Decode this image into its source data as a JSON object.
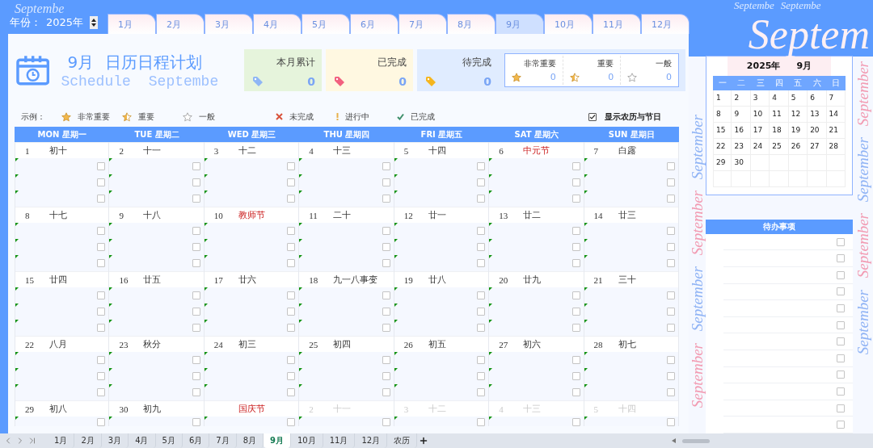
{
  "header": {
    "year_label": "年份：",
    "year": "2025年",
    "watermark": "Septembe",
    "right_watermarks": [
      "Septembe",
      "Septembe"
    ]
  },
  "month_tabs": [
    {
      "label": "1月",
      "selected": false
    },
    {
      "label": "2月",
      "selected": false
    },
    {
      "label": "3月",
      "selected": false
    },
    {
      "label": "4月",
      "selected": false
    },
    {
      "label": "5月",
      "selected": false
    },
    {
      "label": "6月",
      "selected": false
    },
    {
      "label": "7月",
      "selected": false
    },
    {
      "label": "8月",
      "selected": false
    },
    {
      "label": "9月",
      "selected": true
    },
    {
      "label": "10月",
      "selected": false
    },
    {
      "label": "11月",
      "selected": false
    },
    {
      "label": "12月",
      "selected": false
    }
  ],
  "title": {
    "month": "9月",
    "name": "日历日程计划",
    "subtitle": "Schedule",
    "subtitle_month": "Septembe"
  },
  "stats": [
    {
      "kind": "total",
      "label": "本月累计",
      "value": "0"
    },
    {
      "kind": "done",
      "label": "已完成",
      "value": "0"
    },
    {
      "kind": "pending",
      "label": "待完成",
      "value": "0"
    }
  ],
  "priorities": [
    {
      "kind": "star_full",
      "label": "非常重要",
      "value": "0"
    },
    {
      "kind": "star_half",
      "label": "重要",
      "value": "0"
    },
    {
      "kind": "star_empty",
      "label": "一般",
      "value": "0"
    }
  ],
  "legend": {
    "label": "示例：",
    "items": [
      {
        "kind": "star_full",
        "label": "非常重要"
      },
      {
        "kind": "star_half",
        "label": "重要"
      },
      {
        "kind": "star_empty",
        "label": "一般"
      },
      {
        "kind": "cross",
        "label": "未完成"
      },
      {
        "kind": "exclaim",
        "label": "进行中"
      },
      {
        "kind": "tick",
        "label": "已完成"
      }
    ]
  },
  "lunar_toggle": {
    "label": "显示农历与节日",
    "checked": true
  },
  "weekdays": [
    "MON 星期一",
    "TUE 星期二",
    "WED 星期三",
    "THU 星期四",
    "FRI 星期五",
    "SAT 星期六",
    "SUN 星期日"
  ],
  "weeks": [
    {
      "days": [
        {
          "day": "1",
          "lunar": "初十",
          "holiday": false,
          "other_month": false,
          "tasks": [
            {
              "checked": false
            },
            {
              "checked": false
            },
            {
              "checked": false
            }
          ]
        },
        {
          "day": "2",
          "lunar": "十一",
          "holiday": false,
          "other_month": false,
          "tasks": [
            {
              "checked": false
            },
            {
              "checked": false
            },
            {
              "checked": false
            }
          ]
        },
        {
          "day": "3",
          "lunar": "十二",
          "holiday": false,
          "other_month": false,
          "tasks": [
            {
              "checked": false
            },
            {
              "checked": false
            },
            {
              "checked": false
            }
          ]
        },
        {
          "day": "4",
          "lunar": "十三",
          "holiday": false,
          "other_month": false,
          "tasks": [
            {
              "checked": false
            },
            {
              "checked": false
            },
            {
              "checked": false
            }
          ]
        },
        {
          "day": "5",
          "lunar": "十四",
          "holiday": false,
          "other_month": false,
          "tasks": [
            {
              "checked": false
            },
            {
              "checked": false
            },
            {
              "checked": false
            }
          ]
        },
        {
          "day": "6",
          "lunar": "中元节",
          "holiday": true,
          "other_month": false,
          "tasks": [
            {
              "checked": false
            },
            {
              "checked": false
            },
            {
              "checked": false
            }
          ]
        },
        {
          "day": "7",
          "lunar": "白露",
          "holiday": false,
          "other_month": false,
          "tasks": [
            {
              "checked": false
            },
            {
              "checked": false
            },
            {
              "checked": false
            }
          ]
        }
      ]
    },
    {
      "days": [
        {
          "day": "8",
          "lunar": "十七",
          "holiday": false,
          "other_month": false,
          "tasks": [
            {
              "checked": false
            },
            {
              "checked": false
            },
            {
              "checked": false
            }
          ]
        },
        {
          "day": "9",
          "lunar": "十八",
          "holiday": false,
          "other_month": false,
          "tasks": [
            {
              "checked": false
            },
            {
              "checked": false
            },
            {
              "checked": false
            }
          ]
        },
        {
          "day": "10",
          "lunar": "教师节",
          "holiday": true,
          "other_month": false,
          "tasks": [
            {
              "checked": false
            },
            {
              "checked": false
            },
            {
              "checked": false
            }
          ]
        },
        {
          "day": "11",
          "lunar": "二十",
          "holiday": false,
          "other_month": false,
          "tasks": [
            {
              "checked": false
            },
            {
              "checked": false
            },
            {
              "checked": false
            }
          ]
        },
        {
          "day": "12",
          "lunar": "廿一",
          "holiday": false,
          "other_month": false,
          "tasks": [
            {
              "checked": false
            },
            {
              "checked": false
            },
            {
              "checked": false
            }
          ]
        },
        {
          "day": "13",
          "lunar": "廿二",
          "holiday": false,
          "other_month": false,
          "tasks": [
            {
              "checked": false
            },
            {
              "checked": false
            },
            {
              "checked": false
            }
          ]
        },
        {
          "day": "14",
          "lunar": "廿三",
          "holiday": false,
          "other_month": false,
          "tasks": [
            {
              "checked": false
            },
            {
              "checked": false
            },
            {
              "checked": false
            }
          ]
        }
      ]
    },
    {
      "days": [
        {
          "day": "15",
          "lunar": "廿四",
          "holiday": false,
          "other_month": false,
          "tasks": [
            {
              "checked": false
            },
            {
              "checked": false
            },
            {
              "checked": false
            }
          ]
        },
        {
          "day": "16",
          "lunar": "廿五",
          "holiday": false,
          "other_month": false,
          "tasks": [
            {
              "checked": false
            },
            {
              "checked": false
            },
            {
              "checked": false
            }
          ]
        },
        {
          "day": "17",
          "lunar": "廿六",
          "holiday": false,
          "other_month": false,
          "tasks": [
            {
              "checked": false
            },
            {
              "checked": false
            },
            {
              "checked": false
            }
          ]
        },
        {
          "day": "18",
          "lunar": "九一八事变",
          "holiday": false,
          "other_month": false,
          "tasks": [
            {
              "checked": false
            },
            {
              "checked": false
            },
            {
              "checked": false
            }
          ]
        },
        {
          "day": "19",
          "lunar": "廿八",
          "holiday": false,
          "other_month": false,
          "tasks": [
            {
              "checked": false
            },
            {
              "checked": false
            },
            {
              "checked": false
            }
          ]
        },
        {
          "day": "20",
          "lunar": "廿九",
          "holiday": false,
          "other_month": false,
          "tasks": [
            {
              "checked": false
            },
            {
              "checked": false
            },
            {
              "checked": false
            }
          ]
        },
        {
          "day": "21",
          "lunar": "三十",
          "holiday": false,
          "other_month": false,
          "tasks": [
            {
              "checked": false
            },
            {
              "checked": false
            },
            {
              "checked": false
            }
          ]
        }
      ]
    },
    {
      "days": [
        {
          "day": "22",
          "lunar": "八月",
          "holiday": false,
          "other_month": false,
          "tasks": [
            {
              "checked": false
            },
            {
              "checked": false
            },
            {
              "checked": false
            }
          ]
        },
        {
          "day": "23",
          "lunar": "秋分",
          "holiday": false,
          "other_month": false,
          "tasks": [
            {
              "checked": false
            },
            {
              "checked": false
            },
            {
              "checked": false
            }
          ]
        },
        {
          "day": "24",
          "lunar": "初三",
          "holiday": false,
          "other_month": false,
          "tasks": [
            {
              "checked": false
            },
            {
              "checked": false
            },
            {
              "checked": false
            }
          ]
        },
        {
          "day": "25",
          "lunar": "初四",
          "holiday": false,
          "other_month": false,
          "tasks": [
            {
              "checked": false
            },
            {
              "checked": false
            },
            {
              "checked": false
            }
          ]
        },
        {
          "day": "26",
          "lunar": "初五",
          "holiday": false,
          "other_month": false,
          "tasks": [
            {
              "checked": false
            },
            {
              "checked": false
            },
            {
              "checked": false
            }
          ]
        },
        {
          "day": "27",
          "lunar": "初六",
          "holiday": false,
          "other_month": false,
          "tasks": [
            {
              "checked": false
            },
            {
              "checked": false
            },
            {
              "checked": false
            }
          ]
        },
        {
          "day": "28",
          "lunar": "初七",
          "holiday": false,
          "other_month": false,
          "tasks": [
            {
              "checked": false
            },
            {
              "checked": false
            },
            {
              "checked": false
            }
          ]
        }
      ]
    },
    {
      "days": [
        {
          "day": "29",
          "lunar": "初八",
          "holiday": false,
          "other_month": false,
          "tasks": [
            {
              "checked": false
            }
          ]
        },
        {
          "day": "30",
          "lunar": "初九",
          "holiday": false,
          "other_month": false,
          "tasks": [
            {
              "checked": false
            }
          ]
        },
        {
          "lunar": "国庆节",
          "holiday": true,
          "other_month": false,
          "tasks": [
            {
              "checked": false
            }
          ]
        },
        {
          "day": "2",
          "lunar": "十一",
          "holiday": false,
          "other_month": true,
          "tasks": [
            {
              "checked": false
            }
          ]
        },
        {
          "day": "3",
          "lunar": "十二",
          "holiday": false,
          "other_month": true,
          "tasks": [
            {
              "checked": false
            }
          ]
        },
        {
          "day": "4",
          "lunar": "十三",
          "holiday": false,
          "other_month": true,
          "tasks": [
            {
              "checked": false
            }
          ]
        },
        {
          "day": "5",
          "lunar": "十四",
          "holiday": false,
          "other_month": true,
          "tasks": [
            {
              "checked": false
            }
          ]
        }
      ]
    }
  ],
  "mini_calendar": {
    "year": "2025年",
    "month": "9月",
    "weekdays": [
      "一",
      "二",
      "三",
      "四",
      "五",
      "六",
      "日"
    ],
    "rows": [
      [
        "1",
        "2",
        "3",
        "4",
        "5",
        "6",
        "7"
      ],
      [
        "8",
        "9",
        "10",
        "11",
        "12",
        "13",
        "14"
      ],
      [
        "15",
        "16",
        "17",
        "18",
        "19",
        "20",
        "21"
      ],
      [
        "22",
        "23",
        "24",
        "25",
        "26",
        "27",
        "28"
      ],
      [
        "29",
        "30"
      ]
    ]
  },
  "todo": {
    "title": "待办事项",
    "items": [
      {
        "checked": false
      },
      {
        "checked": false
      },
      {
        "checked": false
      },
      {
        "checked": false
      },
      {
        "checked": false
      },
      {
        "checked": false
      },
      {
        "checked": false
      },
      {
        "checked": false
      },
      {
        "checked": false
      },
      {
        "checked": false
      },
      {
        "checked": false
      },
      {
        "checked": false
      }
    ]
  },
  "big_watermark": "Septem",
  "side_watermarks": {
    "left": [
      {
        "text": "September",
        "color": "#8fb3f5"
      },
      {
        "text": "September",
        "color": "#f29bb2"
      },
      {
        "text": "September",
        "color": "#8fb3f5"
      },
      {
        "text": "September",
        "color": "#f29bb2"
      }
    ],
    "right": [
      {
        "text": "September",
        "color": "#f29bb2"
      },
      {
        "text": "September",
        "color": "#8fb3f5"
      },
      {
        "text": "September",
        "color": "#f29bb2"
      },
      {
        "text": "September",
        "color": "#8fb3f5"
      }
    ]
  },
  "sheet_tabs": [
    {
      "label": "1月",
      "selected": false
    },
    {
      "label": "2月",
      "selected": false
    },
    {
      "label": "3月",
      "selected": false
    },
    {
      "label": "4月",
      "selected": false
    },
    {
      "label": "5月",
      "selected": false
    },
    {
      "label": "6月",
      "selected": false
    },
    {
      "label": "7月",
      "selected": false
    },
    {
      "label": "8月",
      "selected": false
    },
    {
      "label": "9月",
      "selected": true
    },
    {
      "label": "10月",
      "selected": false
    },
    {
      "label": "11月",
      "selected": false
    },
    {
      "label": "12月",
      "selected": false
    },
    {
      "label": "农历",
      "selected": false
    }
  ]
}
